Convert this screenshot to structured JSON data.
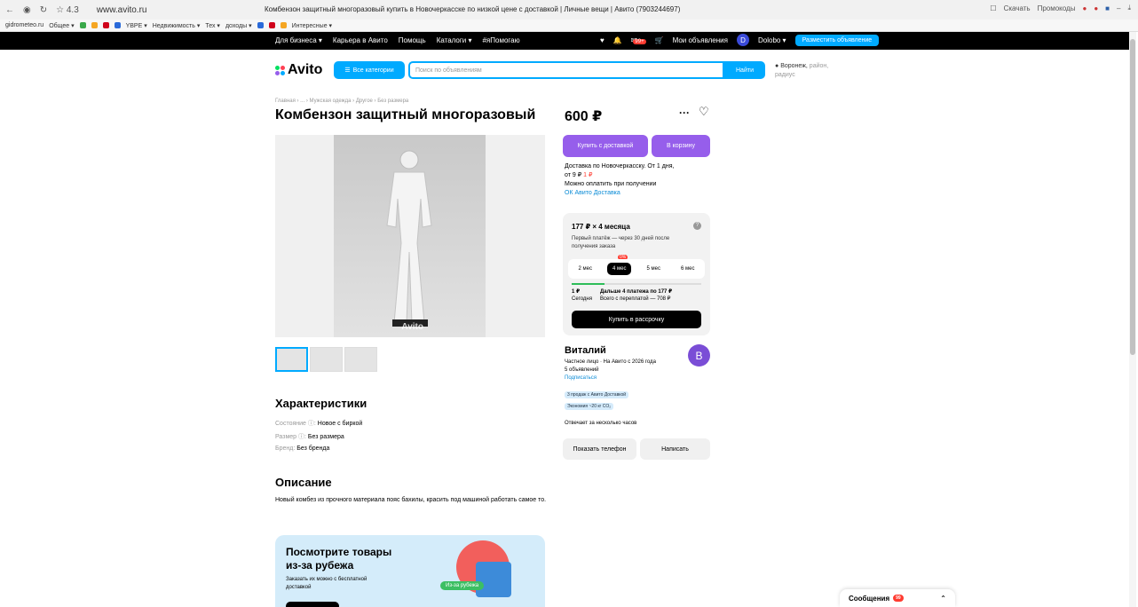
{
  "browser": {
    "page_title": "Комбензон защитный многоразовый купить в Новочеркасске по низкой цене с доставкой | Личные вещи | Авито (7903244697)",
    "url": "www.avito.ru",
    "stat": "☆ 4.3",
    "bookmarks": [
      "gidrometeo.ru",
      "Общее ▾",
      "YBPE ▾",
      "Недвижимость ▾",
      "Тех ▾",
      "доходы ▾",
      "Интересные ▾"
    ],
    "right_items": [
      "Скачать",
      "Промокоды"
    ]
  },
  "topbar": {
    "left_links": [
      "Для бизнеса ▾",
      "Карьера в Авито",
      "Помощь",
      "Каталоги ▾",
      "#яПомогаю"
    ],
    "messages_count": "99+",
    "my_ads": "Мои объявления",
    "user_initial": "D",
    "user_name": "Dolobo ▾",
    "post_button": "Разместить объявление"
  },
  "header": {
    "logo": "Avito",
    "all_categories": "Все категории",
    "search_placeholder": "Поиск по объявлениям",
    "search_button": "Найти",
    "location": "Воронеж,",
    "location_more": "район, радиус"
  },
  "breadcrumb": "Главная › ... › Мужская одежда › Другое › Без размера",
  "listing": {
    "title": "Комбензон защитный многоразовый",
    "price": "600 ₽",
    "watermark": "Avito"
  },
  "characteristics": {
    "heading": "Характеристики",
    "rows": [
      {
        "key": "Состояние ⓘ:",
        "value": "Новое с биркой"
      },
      {
        "key": "Размер ⓘ:",
        "value": "Без размера"
      },
      {
        "key": "Бренд:",
        "value": "Без бренда"
      }
    ]
  },
  "description": {
    "heading": "Описание",
    "text": "Новый комбез из прочного материала пояс бахилы, красить под машиной работать самое то."
  },
  "promo": {
    "heading_1": "Посмотрите товары",
    "heading_2": "из-за рубежа",
    "text": "Заказать их можно с бесплатной доставкой",
    "tag": "Из-за рубежа"
  },
  "actions": {
    "buy_delivery": "Купить с доставкой",
    "to_cart": "В корзину"
  },
  "delivery": {
    "line1": "Доставка по Новочеркасску. От 1 дня,",
    "line2_prefix": "от 9 ₽",
    "line2_red": "1 ₽",
    "line3": "Можно оплатить при получении",
    "link": "ОК Авито Доставка"
  },
  "installment": {
    "heading": "177 ₽ × 4 месяца",
    "sub": "Первый платёж — через 30 дней после получения заказа",
    "options": [
      "2 мес",
      "4 мес",
      "5 мес",
      "6 мес"
    ],
    "option_badge": "0%",
    "progress": 0.25,
    "today_amount": "1 ₽",
    "today_label": "Сегодня",
    "next_text": "Дальше 4 платежа по 177 ₽",
    "overpay": "Всего с переплатой — 708 ₽",
    "button": "Купить в рассрочку"
  },
  "seller": {
    "name": "Виталий",
    "initial": "В",
    "type": "Частное лицо · На Авито с 2026 года",
    "ads": "5 объявлений",
    "subscribe": "Подписаться",
    "chip1": "3 продаж с Авито Доставкой",
    "chip2": "Экономия ~20 кг CO₂",
    "reply": "Отвечает за несколько часов",
    "show_phone": "Показать телефон",
    "write": "Написать"
  },
  "messages_widget": {
    "label": "Сообщения",
    "badge": "99",
    "chevron": "⌃"
  }
}
